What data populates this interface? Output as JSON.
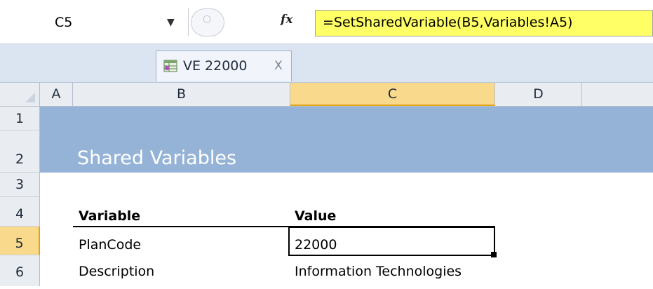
{
  "formula_bar": {
    "name_box": "C5",
    "formula": "=SetSharedVariable(B5,Variables!A5)"
  },
  "workbook_tab": {
    "label": "VE 22000",
    "close": "X"
  },
  "columns": [
    "A",
    "B",
    "C",
    "D"
  ],
  "active_column": "C",
  "rows": [
    "1",
    "2",
    "3",
    "4",
    "5",
    "6"
  ],
  "active_row": "5",
  "sheet": {
    "title": "Shared Variables",
    "header_variable": "Variable",
    "header_value": "Value",
    "row5_variable": "PlanCode",
    "row5_value": "22000",
    "row6_variable": "Description",
    "row6_value": "Information Technologies"
  },
  "colors": {
    "title_band": "#95b3d7",
    "formula_highlight": "#ffff66",
    "active_header": "#f9d98b"
  }
}
